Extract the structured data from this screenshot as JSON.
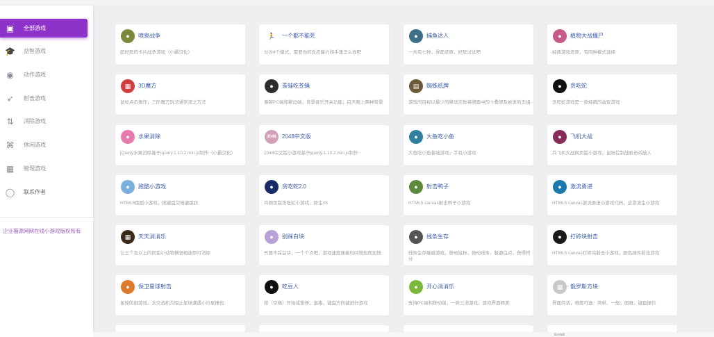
{
  "sidebar": {
    "items": [
      {
        "label": "全部游戏",
        "icon": "tv-icon",
        "glyph": "▣",
        "active": true
      },
      {
        "label": "益智游戏",
        "icon": "graduation-cap-icon",
        "glyph": "🎓",
        "active": false
      },
      {
        "label": "动作游戏",
        "icon": "robot-icon",
        "glyph": "◉",
        "active": false
      },
      {
        "label": "射击游戏",
        "icon": "rocket-icon",
        "glyph": "➶",
        "active": false
      },
      {
        "label": "消除游戏",
        "icon": "swap-icon",
        "glyph": "⇅",
        "active": false
      },
      {
        "label": "休闲游戏",
        "icon": "puzzle-icon",
        "glyph": "⌘",
        "active": false
      },
      {
        "label": "物理游戏",
        "icon": "blocks-icon",
        "glyph": "▦",
        "active": false
      },
      {
        "label": "联系作者",
        "icon": "user-icon",
        "glyph": "◯",
        "active": false
      }
    ],
    "copyright": "企业猫源网网在线小游戏版权所有"
  },
  "games": [
    {
      "title": "喷泉战争",
      "desc": "超好玩的卡片战争游戏（小霸汉化）",
      "icon": "tank-icon",
      "color": "#7a8a3a",
      "glyph": "●"
    },
    {
      "title": "一个都不能死",
      "desc": "分为4个模式，需要你的反应能力和手速怎么样吧",
      "icon": "runner-icon",
      "color": "#ffffff",
      "glyph": "🏃"
    },
    {
      "title": "捕鱼达人",
      "desc": "一共有七种，界面还原，好玩试试吧",
      "icon": "fish-icon",
      "color": "#3b6f8a",
      "glyph": "●"
    },
    {
      "title": "植物大战僵尸",
      "desc": "经典游戏还原，有同种模式选择",
      "icon": "zombie-icon",
      "color": "#c85a8a",
      "glyph": "●"
    },
    {
      "title": "3D魔方",
      "desc": "鼠标点击操作，三阶魔方玩法通常流之方法",
      "icon": "cube-icon",
      "color": "#d23b3b",
      "glyph": "▦"
    },
    {
      "title": "青蛙吃苍蝇",
      "desc": "兼容PC端和移动端，背景音乐开关功能，白天晚上两种背景",
      "icon": "frog-icon",
      "color": "#2e2e2e",
      "glyph": "●"
    },
    {
      "title": "蜘蛛纸牌",
      "desc": "游戏的目标以最少的移动次数将牌面中的十叠牌及依发的五组",
      "icon": "cards-icon",
      "color": "#6b5a3a",
      "glyph": "▤"
    },
    {
      "title": "贪吃蛇",
      "desc": "贪吃蛇游戏是一款经典的益智游戏",
      "icon": "snake-icon",
      "color": "#111111",
      "glyph": "●"
    },
    {
      "title": "水果消除",
      "desc": "jQuery水果消除基于jquery.1.10.2.min.js制作（小霸汉化）",
      "icon": "fruit-icon",
      "color": "#e87ab0",
      "glyph": "●"
    },
    {
      "title": "2048中文版",
      "desc": "2048中文版小游戏基于jquery.1.10.2.min.js制作",
      "icon": "tile-2048-icon",
      "color": "#d4a0b8",
      "glyph": "2048"
    },
    {
      "title": "大鱼吃小鱼",
      "desc": "大鱼吃小鱼基础游戏，手机小游戏",
      "icon": "big-fish-icon",
      "color": "#2f7fa0",
      "glyph": "●"
    },
    {
      "title": "飞机大战",
      "desc": "兵飞机大战网页版小游戏，鼠标控制战机击杀敌人",
      "icon": "plane-icon",
      "color": "#8a2a5a",
      "glyph": "●"
    },
    {
      "title": "跑酷小游戏",
      "desc": "HTML5跑酷小游戏，按键盘空格键跳跃",
      "icon": "parkour-icon",
      "color": "#7ab0e0",
      "glyph": "●"
    },
    {
      "title": "贪吃蛇2.0",
      "desc": "兵网页版贪吃蛇小游戏，原生JS",
      "icon": "snake-two-icon",
      "color": "#1a2a6a",
      "glyph": "●"
    },
    {
      "title": "射击鸭子",
      "desc": "HTML5 canvas射击鸭子小游戏",
      "icon": "duck-icon",
      "color": "#5a8a3a",
      "glyph": "●"
    },
    {
      "title": "激流勇进",
      "desc": "HTML5 canvas激流勇进小游戏代码，这游流生小游戏",
      "icon": "rapids-icon",
      "color": "#1a7ab0",
      "glyph": "●"
    },
    {
      "title": "天天消消乐",
      "desc": "让三个及以上的同色小动物横竖相连即可消除",
      "icon": "match-three-icon",
      "color": "#3a2a1a",
      "glyph": "▦"
    },
    {
      "title": "别踩白块",
      "desc": "只要不踩白块，一个个点吧，游戏速度随着时间增加而加快",
      "icon": "piano-tile-icon",
      "color": "#b8a0d8",
      "glyph": "●"
    },
    {
      "title": "线条生存",
      "desc": "线条生存躲避游戏，移动鼠标，拖动线条，躲避白点，获得积分",
      "icon": "line-survive-icon",
      "color": "#555555",
      "glyph": "●"
    },
    {
      "title": "打砖块射击",
      "desc": "HTML5 canvas打砖块射击小游戏，颜色随件射击游戏",
      "icon": "brick-shoot-icon",
      "color": "#1a1a1a",
      "glyph": "●"
    },
    {
      "title": "保卫星球射击",
      "desc": "星球防御游戏，太空战机为阻止星球遭遇小行星撞击",
      "icon": "planet-icon",
      "color": "#e07a2a",
      "glyph": "●"
    },
    {
      "title": "吃豆人",
      "desc": "按（空格）开始或暂停，退格，键盘方向键进行游戏",
      "icon": "pacman-icon",
      "color": "#111111",
      "glyph": "●"
    },
    {
      "title": "开心消消乐",
      "desc": "支持PC端和移动端，一款三消游戏，游戏界面精美",
      "icon": "happy-match-icon",
      "color": "#7ab83a",
      "glyph": "●"
    },
    {
      "title": "俄罗斯方块",
      "desc": "界面简洁，难度可选：简单、一般、困难，键盘操作",
      "icon": "tetris-icon",
      "color": "#c8c8c8",
      "glyph": "▦"
    }
  ],
  "statusbar": {
    "left_label": "Ecolab"
  }
}
